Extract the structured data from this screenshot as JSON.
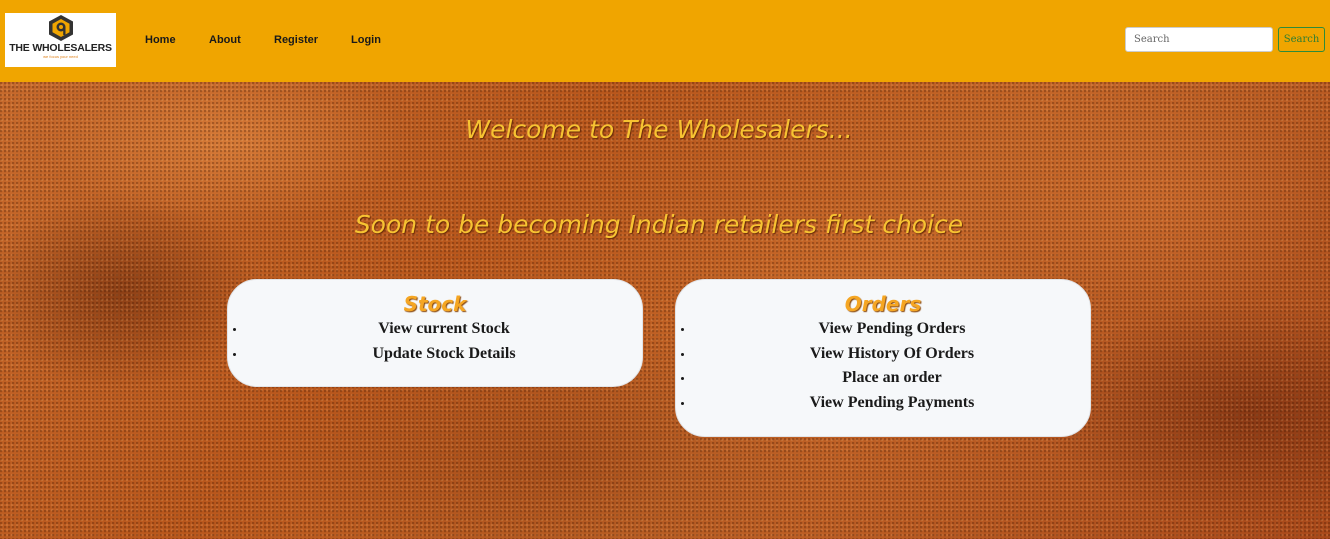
{
  "navbar": {
    "logo": {
      "title": "THE WHOLESALERS",
      "tagline": "we focus your need",
      "colors": {
        "accent": "#f0a500",
        "dark": "#333333"
      }
    },
    "links": [
      {
        "label": "Home"
      },
      {
        "label": "About"
      },
      {
        "label": "Register"
      },
      {
        "label": "Login"
      }
    ],
    "search": {
      "placeholder": "Search",
      "button_label": "Search"
    },
    "background_color": "#f0a500"
  },
  "hero": {
    "welcome": "Welcome to The Wholesalers...",
    "subtitle": "Soon to be becoming Indian retailers first choice",
    "heading_color": "#f7c332"
  },
  "cards": {
    "stock": {
      "title": "Stock",
      "items": [
        {
          "label": "View current Stock"
        },
        {
          "label": "Update Stock Details"
        }
      ]
    },
    "orders": {
      "title": "Orders",
      "items": [
        {
          "label": "View Pending Orders"
        },
        {
          "label": "View History Of Orders"
        },
        {
          "label": "Place an order"
        },
        {
          "label": "View Pending Payments"
        }
      ]
    }
  }
}
